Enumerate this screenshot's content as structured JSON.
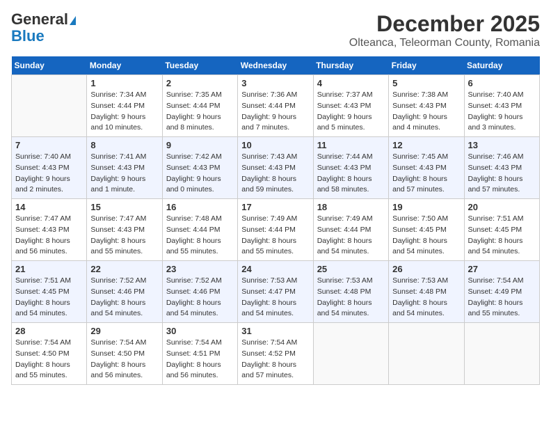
{
  "header": {
    "logo_general": "General",
    "logo_blue": "Blue",
    "month_title": "December 2025",
    "location": "Olteanca, Teleorman County, Romania"
  },
  "days_of_week": [
    "Sunday",
    "Monday",
    "Tuesday",
    "Wednesday",
    "Thursday",
    "Friday",
    "Saturday"
  ],
  "weeks": [
    [
      {
        "day": null
      },
      {
        "day": "1",
        "sunrise": "7:34 AM",
        "sunset": "4:44 PM",
        "daylight": "9 hours and 10 minutes."
      },
      {
        "day": "2",
        "sunrise": "7:35 AM",
        "sunset": "4:44 PM",
        "daylight": "9 hours and 8 minutes."
      },
      {
        "day": "3",
        "sunrise": "7:36 AM",
        "sunset": "4:44 PM",
        "daylight": "9 hours and 7 minutes."
      },
      {
        "day": "4",
        "sunrise": "7:37 AM",
        "sunset": "4:43 PM",
        "daylight": "9 hours and 5 minutes."
      },
      {
        "day": "5",
        "sunrise": "7:38 AM",
        "sunset": "4:43 PM",
        "daylight": "9 hours and 4 minutes."
      },
      {
        "day": "6",
        "sunrise": "7:40 AM",
        "sunset": "4:43 PM",
        "daylight": "9 hours and 3 minutes."
      }
    ],
    [
      {
        "day": "7",
        "sunrise": "7:40 AM",
        "sunset": "4:43 PM",
        "daylight": "9 hours and 2 minutes."
      },
      {
        "day": "8",
        "sunrise": "7:41 AM",
        "sunset": "4:43 PM",
        "daylight": "9 hours and 1 minute."
      },
      {
        "day": "9",
        "sunrise": "7:42 AM",
        "sunset": "4:43 PM",
        "daylight": "9 hours and 0 minutes."
      },
      {
        "day": "10",
        "sunrise": "7:43 AM",
        "sunset": "4:43 PM",
        "daylight": "8 hours and 59 minutes."
      },
      {
        "day": "11",
        "sunrise": "7:44 AM",
        "sunset": "4:43 PM",
        "daylight": "8 hours and 58 minutes."
      },
      {
        "day": "12",
        "sunrise": "7:45 AM",
        "sunset": "4:43 PM",
        "daylight": "8 hours and 57 minutes."
      },
      {
        "day": "13",
        "sunrise": "7:46 AM",
        "sunset": "4:43 PM",
        "daylight": "8 hours and 57 minutes."
      }
    ],
    [
      {
        "day": "14",
        "sunrise": "7:47 AM",
        "sunset": "4:43 PM",
        "daylight": "8 hours and 56 minutes."
      },
      {
        "day": "15",
        "sunrise": "7:47 AM",
        "sunset": "4:43 PM",
        "daylight": "8 hours and 55 minutes."
      },
      {
        "day": "16",
        "sunrise": "7:48 AM",
        "sunset": "4:44 PM",
        "daylight": "8 hours and 55 minutes."
      },
      {
        "day": "17",
        "sunrise": "7:49 AM",
        "sunset": "4:44 PM",
        "daylight": "8 hours and 55 minutes."
      },
      {
        "day": "18",
        "sunrise": "7:49 AM",
        "sunset": "4:44 PM",
        "daylight": "8 hours and 54 minutes."
      },
      {
        "day": "19",
        "sunrise": "7:50 AM",
        "sunset": "4:45 PM",
        "daylight": "8 hours and 54 minutes."
      },
      {
        "day": "20",
        "sunrise": "7:51 AM",
        "sunset": "4:45 PM",
        "daylight": "8 hours and 54 minutes."
      }
    ],
    [
      {
        "day": "21",
        "sunrise": "7:51 AM",
        "sunset": "4:45 PM",
        "daylight": "8 hours and 54 minutes."
      },
      {
        "day": "22",
        "sunrise": "7:52 AM",
        "sunset": "4:46 PM",
        "daylight": "8 hours and 54 minutes."
      },
      {
        "day": "23",
        "sunrise": "7:52 AM",
        "sunset": "4:46 PM",
        "daylight": "8 hours and 54 minutes."
      },
      {
        "day": "24",
        "sunrise": "7:53 AM",
        "sunset": "4:47 PM",
        "daylight": "8 hours and 54 minutes."
      },
      {
        "day": "25",
        "sunrise": "7:53 AM",
        "sunset": "4:48 PM",
        "daylight": "8 hours and 54 minutes."
      },
      {
        "day": "26",
        "sunrise": "7:53 AM",
        "sunset": "4:48 PM",
        "daylight": "8 hours and 54 minutes."
      },
      {
        "day": "27",
        "sunrise": "7:54 AM",
        "sunset": "4:49 PM",
        "daylight": "8 hours and 55 minutes."
      }
    ],
    [
      {
        "day": "28",
        "sunrise": "7:54 AM",
        "sunset": "4:50 PM",
        "daylight": "8 hours and 55 minutes."
      },
      {
        "day": "29",
        "sunrise": "7:54 AM",
        "sunset": "4:50 PM",
        "daylight": "8 hours and 56 minutes."
      },
      {
        "day": "30",
        "sunrise": "7:54 AM",
        "sunset": "4:51 PM",
        "daylight": "8 hours and 56 minutes."
      },
      {
        "day": "31",
        "sunrise": "7:54 AM",
        "sunset": "4:52 PM",
        "daylight": "8 hours and 57 minutes."
      },
      {
        "day": null
      },
      {
        "day": null
      },
      {
        "day": null
      }
    ]
  ]
}
